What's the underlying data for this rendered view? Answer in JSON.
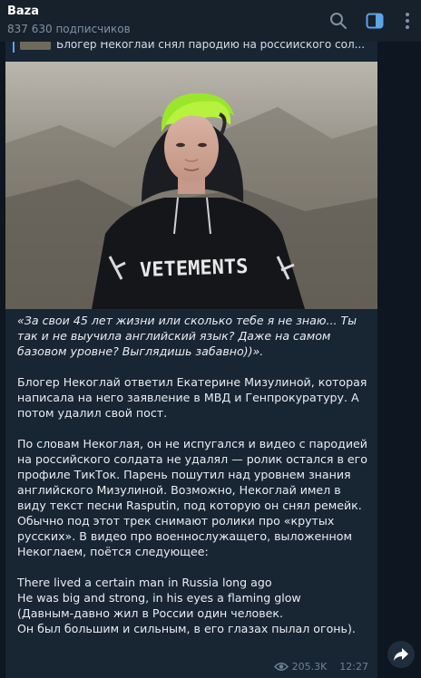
{
  "header": {
    "channel_name": "Baza",
    "subscribers": "837 630 подписчиков"
  },
  "icons": {
    "search": "search-icon",
    "sidebar": "sidebar-toggle-icon",
    "more": "more-vertical-icon",
    "views": "eye-icon",
    "share": "share-arrow-icon"
  },
  "colors": {
    "accent": "#5ea3e7",
    "background": "#0e1621",
    "bubble": "#182533"
  },
  "message": {
    "reply_text": "Блогер Некоглай снял пародию на российского сол...",
    "paragraphs": [
      "«За свои 45 лет жизни или сколько тебе я не знаю... Ты так и не выучила английский язык? Даже на самом базовом уровне? Выглядишь забавно))».",
      "Блогер Некоглай ответил Екатерине Мизулиной, которая написала на него заявление в МВД и Генпрокуратуру. А потом удалил свой пост.",
      "По словам Некоглая, он не испугался и видео с пародией на российского солдата не удалял — ролик остался в его профиле ТикТок. Парень пошутил над уровнем знания английского Мизулиной. Возможно, Некоглай имел в виду текст песни Rasputin, под которую он снял ремейк. Обычно под этот трек снимают ролики про «крутых русских». В видео про военнослужащего, выложенном Некоглаем, поётся следующее:"
    ],
    "lyrics": [
      "There lived a certain man in Russia long ago",
      "He was big and strong, in his eyes a flaming glow",
      "(Давным-давно жил в России один человек.",
      "Он был большим и сильным, в его глазах пылал огонь)."
    ],
    "photo_hoodie_text": "VETEMENTS",
    "views": "205.3K",
    "time": "12:27"
  }
}
